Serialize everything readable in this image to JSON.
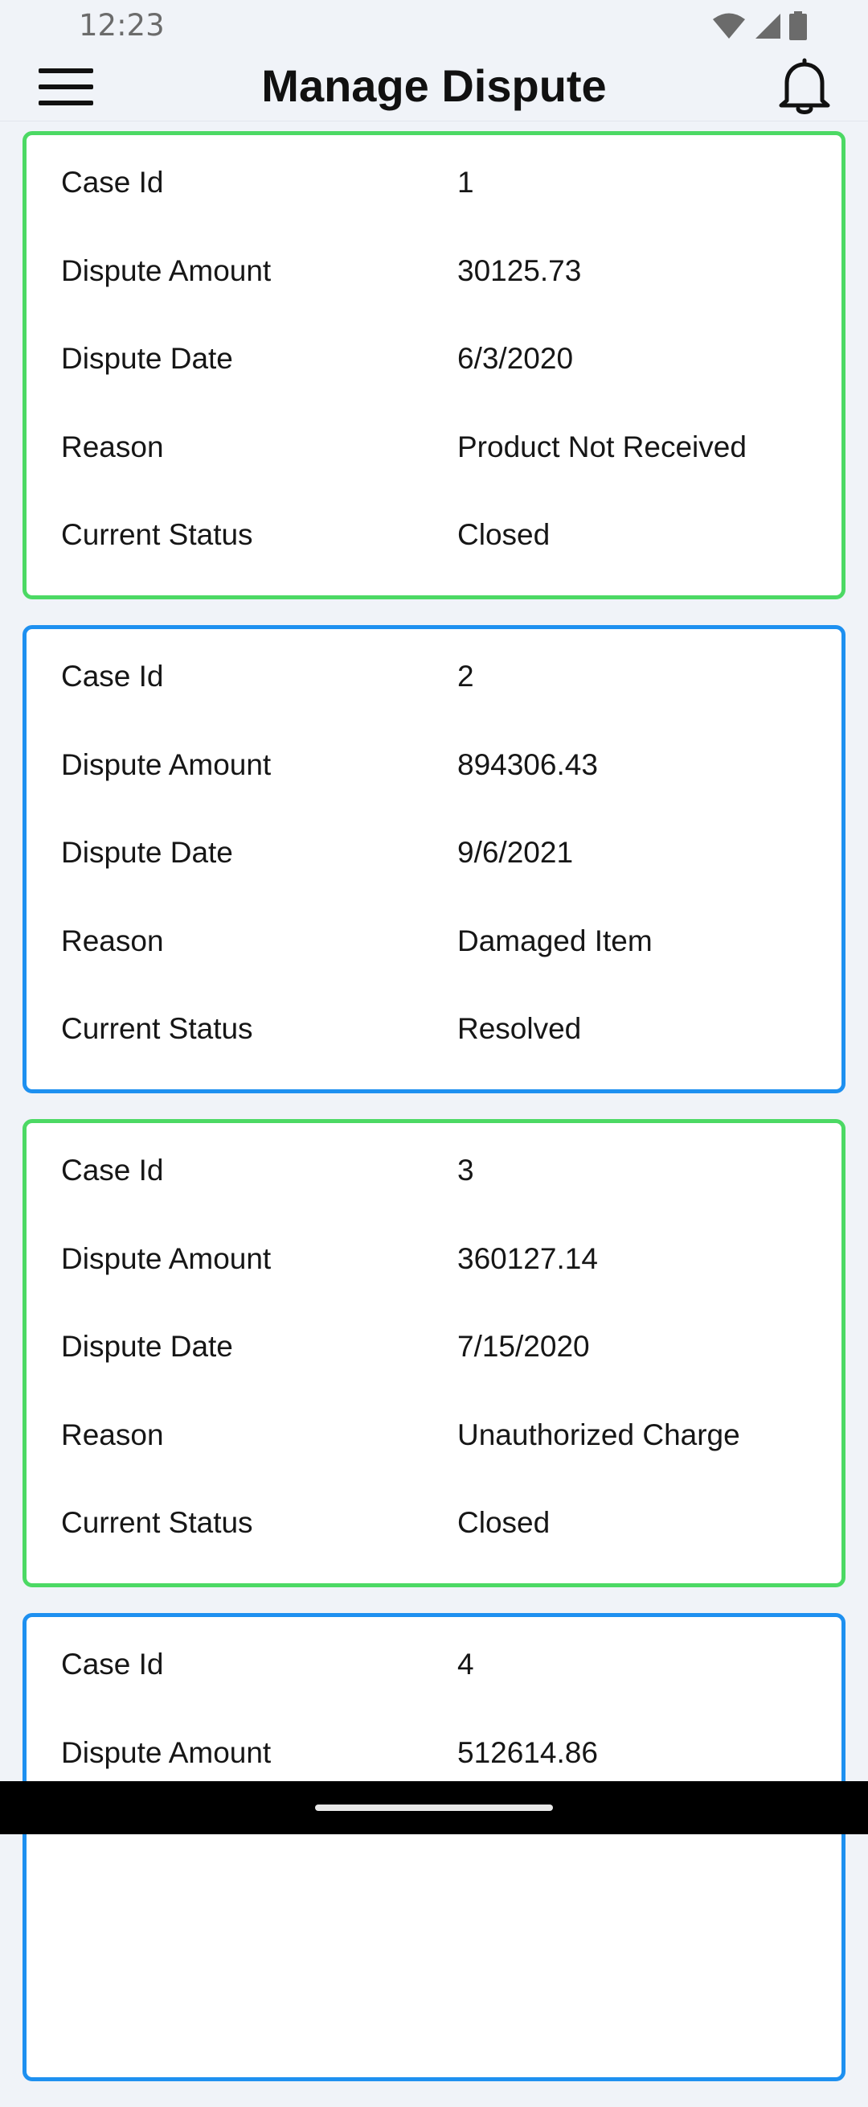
{
  "status_bar": {
    "time": "12:23",
    "icons": [
      "wifi-icon",
      "cellular-signal-icon",
      "battery-icon"
    ]
  },
  "app_bar": {
    "title": "Manage Dispute",
    "menu_icon": "hamburger-menu-icon",
    "notification_icon": "bell-icon"
  },
  "colors": {
    "background": "#f0f3f8",
    "card_green_border": "#4cd964",
    "card_blue_border": "#1e90f0"
  },
  "field_labels": {
    "case_id": "Case Id",
    "amount": "Dispute Amount",
    "date": "Dispute Date",
    "reason": "Reason",
    "status": "Current Status"
  },
  "disputes": [
    {
      "case_id": "1",
      "amount": "30125.73",
      "date": "6/3/2020",
      "reason": "Product Not Received",
      "status": "Closed",
      "border": "green"
    },
    {
      "case_id": "2",
      "amount": "894306.43",
      "date": "9/6/2021",
      "reason": "Damaged Item",
      "status": "Resolved",
      "border": "blue"
    },
    {
      "case_id": "3",
      "amount": "360127.14",
      "date": "7/15/2020",
      "reason": "Unauthorized Charge",
      "status": "Closed",
      "border": "green"
    },
    {
      "case_id": "4",
      "amount": "512614.86",
      "border": "blue"
    }
  ]
}
